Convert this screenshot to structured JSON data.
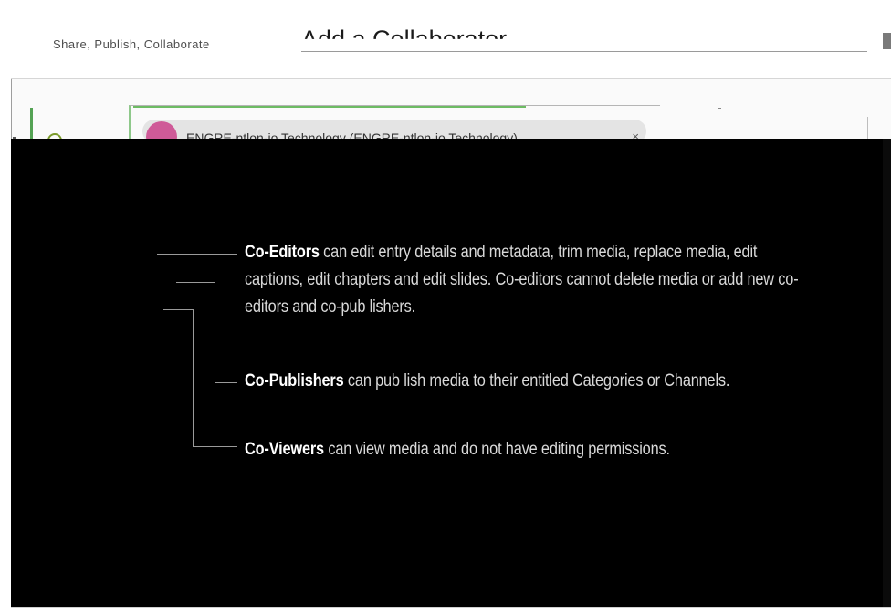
{
  "window": {
    "garbled_header": "Share, Publish, Collaborate",
    "dialog_title": "Add a Collaborator"
  },
  "dialog": {
    "collaborator_chip": {
      "label": "ENGRE-ntlon-io Technology (ENGRE-ntlon-io Technology)",
      "remove_glyph": "×"
    }
  },
  "help_overlay": {
    "items": [
      {
        "role": "Co-Editors",
        "text": " can edit entry details and metadata, trim media, replace media, edit captions, edit chapters and edit slides. Co-editors cannot delete media or add new co-editors and co-pub lishers."
      },
      {
        "role": "Co-Publishers",
        "text": " can pub lish media to their entitled Categories or Channels."
      },
      {
        "role": "Co-Viewers",
        "text": " can view media and do not have editing permissions."
      }
    ]
  },
  "colors": {
    "overlay_background": "#000000",
    "overlay_text": "#d9d9d9",
    "role_text": "#ffffff",
    "connector_line": "#9a9a9a",
    "step_green": "#54a254",
    "avatar_pink": "#cf5a98",
    "chip_background": "#e4e4e4"
  },
  "icons": {
    "avatar": "group-avatar-icon",
    "step": "step-indicator-icon",
    "remove": "close-icon"
  }
}
